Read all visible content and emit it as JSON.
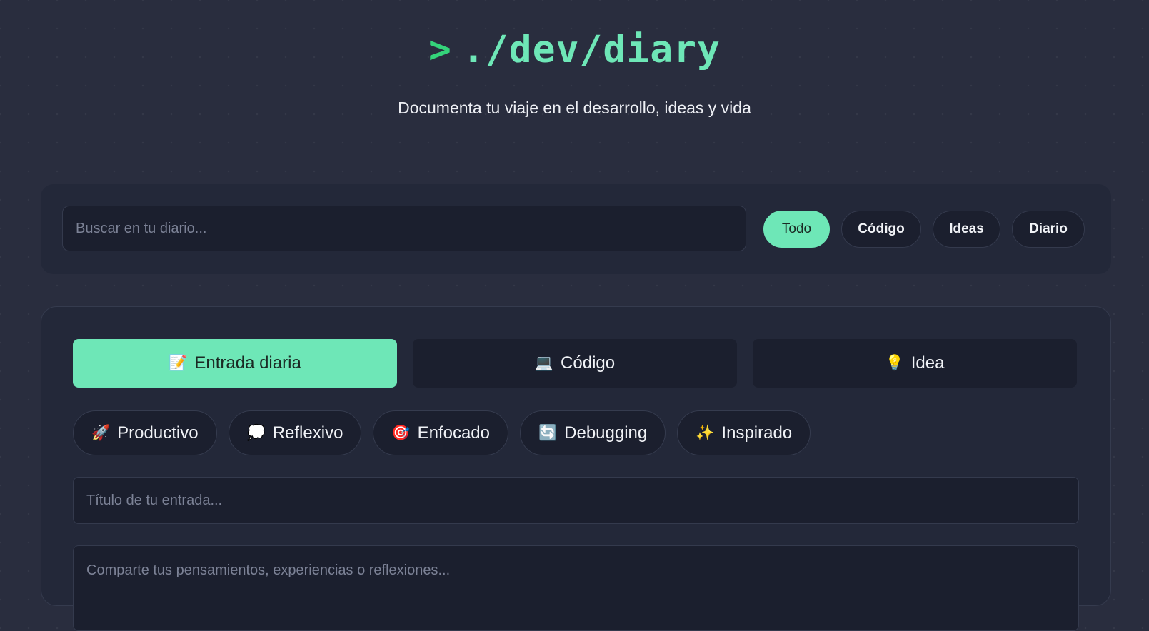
{
  "header": {
    "prompt_symbol": ">",
    "title": "./dev/diary",
    "subtitle": "Documenta tu viaje en el desarrollo, ideas y vida"
  },
  "search": {
    "placeholder": "Buscar en tu diario...",
    "value": ""
  },
  "filters": [
    {
      "label": "Todo",
      "active": true
    },
    {
      "label": "Código",
      "active": false
    },
    {
      "label": "Ideas",
      "active": false
    },
    {
      "label": "Diario",
      "active": false
    }
  ],
  "entry_types": [
    {
      "emoji": "📝",
      "label": "Entrada diaria",
      "icon": "memo-icon",
      "active": true
    },
    {
      "emoji": "💻",
      "label": "Código",
      "icon": "laptop-icon",
      "active": false
    },
    {
      "emoji": "💡",
      "label": "Idea",
      "icon": "lightbulb-icon",
      "active": false
    }
  ],
  "moods": [
    {
      "emoji": "🚀",
      "label": "Productivo",
      "icon": "rocket-icon"
    },
    {
      "emoji": "💭",
      "label": "Reflexivo",
      "icon": "thought-bubble-icon"
    },
    {
      "emoji": "🎯",
      "label": "Enfocado",
      "icon": "target-icon"
    },
    {
      "emoji": "🔄",
      "label": "Debugging",
      "icon": "refresh-icon"
    },
    {
      "emoji": "✨",
      "label": "Inspirado",
      "icon": "sparkles-icon"
    }
  ],
  "form": {
    "title_placeholder": "Título de tu entrada...",
    "content_placeholder": "Comparte tus pensamientos, experiencias o reflexiones..."
  },
  "colors": {
    "background": "#292d3e",
    "panel": "#232839",
    "accent": "#6ee7b7",
    "prompt": "#34d37a"
  }
}
